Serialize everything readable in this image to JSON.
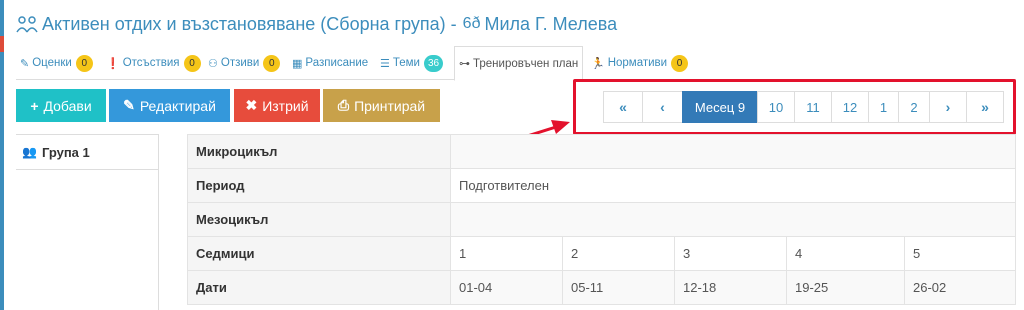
{
  "header": {
    "title": "Активен отдих и възстановяване (Сборна група) -",
    "teacher": "Мила Г. Мелева"
  },
  "tabs": [
    {
      "label": "Оценки",
      "badge": "0",
      "icon": "pencil-icon"
    },
    {
      "label": "Отсъствия",
      "badge": "0",
      "icon": "exclamation-circle-icon"
    },
    {
      "label": "Отзиви",
      "badge": "0",
      "icon": "user-comment-icon"
    },
    {
      "label": "Разписание",
      "icon": "table-icon"
    },
    {
      "label": "Теми",
      "badge": "36",
      "icon": "list-icon"
    },
    {
      "label": "Тренировъчен план",
      "icon": "dumbbell-icon",
      "active": true
    },
    {
      "label": "Нормативи",
      "badge": "0",
      "icon": "running-icon"
    }
  ],
  "toolbar": {
    "add_label": "Добави",
    "edit_label": "Редактирай",
    "delete_label": "Изтрий",
    "print_label": "Принтирай"
  },
  "pagination": {
    "first": "«",
    "prev": "‹",
    "current": "Месец 9",
    "pages": [
      "10",
      "11",
      "12",
      "1",
      "2"
    ],
    "next": "›",
    "last": "»"
  },
  "groups": [
    {
      "label": "Група 1"
    }
  ],
  "table": {
    "rows": [
      {
        "label": "Микроцикъл",
        "values": []
      },
      {
        "label": "Период",
        "values": [
          "Подготвителен"
        ]
      },
      {
        "label": "Мезоцикъл",
        "values": []
      },
      {
        "label": "Седмици",
        "values": [
          "1",
          "2",
          "3",
          "4",
          "5"
        ]
      },
      {
        "label": "Дати",
        "values": [
          "01-04",
          "05-11",
          "12-18",
          "19-25",
          "26-02"
        ]
      }
    ]
  },
  "colors": {
    "accent": "#3c8dbc",
    "add": "#1fc1c7",
    "edit": "#3498db",
    "delete": "#e74c3c",
    "print": "#c8a14a",
    "annotation": "#e3122d"
  }
}
